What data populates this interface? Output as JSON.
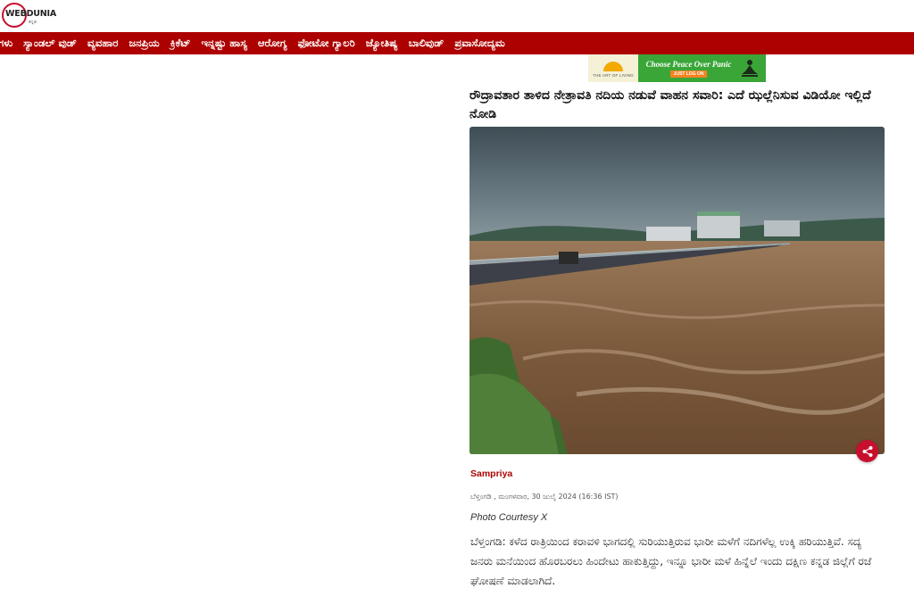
{
  "header": {
    "logo_text": "WEBDUNIA",
    "logo_sub": "ಕನ್ನಡ"
  },
  "nav": {
    "items": [
      "ಗಳು",
      "ಸ್ಯಾಂಡಲ್ ವುಡ್",
      "ವ್ಯವಹಾರ",
      "ಜನಪ್ರಿಯ",
      "ಕ್ರಿಕೆಟ್",
      "ಇನ್ನಷ್ಟು ಹಾಸ್ಯ",
      "ಆರೋಗ್ಯ",
      "ಫೋಟೋ ಗ್ಯಾಲರಿ",
      "ಜ್ಯೋತಿಷ್ಯ",
      "ಬಾಲಿವುಡ್",
      "ಪ್ರವಾಸೋದ್ಯಮ"
    ]
  },
  "ad": {
    "logo_caption": "THE ART OF LIVING",
    "title": "Choose Peace Over Panic",
    "cta": "JUST LOG ON"
  },
  "article": {
    "headline": "ರೌದ್ರಾವತಾರ ತಾಳಿದ ನೇತ್ರಾವತಿ ನದಿಯ ನಡುವೆ ವಾಹನ ಸವಾರಿ: ಎದೆ ಝಲ್ಲೆನಿಸುವ ವಿಡಿಯೋ ಇಲ್ಲಿದೆ ನೋಡಿ",
    "author": "Sampriya",
    "dateline": "ಬೆಳ್ತಂಗಡಿ , ಮಂಗಳವಾರ, 30 ಜುಲೈ 2024 (16:36 IST)",
    "photo_courtesy": "Photo Courtesy X",
    "body": "ಬೆಳ್ತಂಗಡಿ: ಕಳೆದ ರಾತ್ರಿಯಿಂದ ಕರಾವಳಿ ಭಾಗದಲ್ಲಿ ಸುರಿಯುತ್ತಿರುವ ಭಾರೀ ಮಳೆಗೆ ನದಿಗಳೆಲ್ಲ ಉಕ್ಕಿ ಹರಿಯುತ್ತಿವೆ. ಸದ್ಯ ಜನರು ಮನೆಯಿಂದ ಹೊರಬರಲು ಹಿಂದೇಟು ಹಾಕುತ್ತಿದ್ದು, ಇನ್ನೂ ಭಾರೀ ಮಳೆ ಹಿನ್ನೆಲೆ ಇಂದು ದಕ್ಷಿಣ ಕನ್ನಡ ಜಿಲ್ಲೆಗೆ ರಜೆ ಘೋಷಣೆ ಮಾಡಲಾಗಿದೆ."
  },
  "colors": {
    "brand_red": "#ad0000",
    "ad_green": "#3aa638",
    "share_red": "#c8102e"
  },
  "icons": {
    "share": "share-icon"
  }
}
